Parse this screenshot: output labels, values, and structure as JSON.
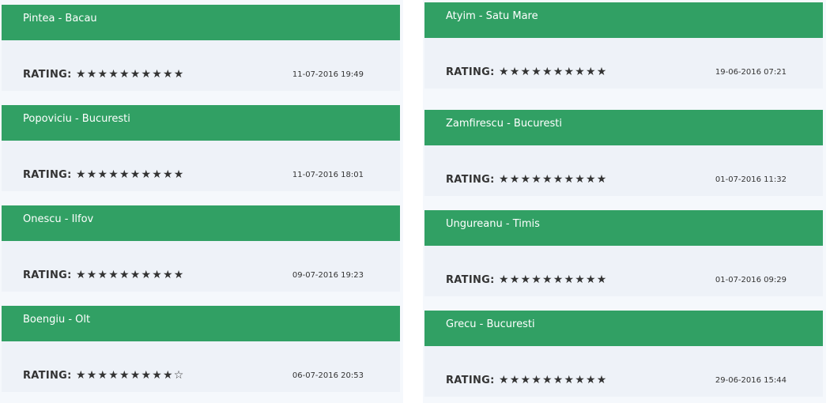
{
  "rating_label": "RATING:",
  "reviews_left": [
    {
      "name": "Pintea - Bacau",
      "stars": "★★★★★★★★★★",
      "date": "11-07-2016 19:49"
    },
    {
      "name": "Popoviciu - Bucuresti",
      "stars": "★★★★★★★★★★",
      "date": "11-07-2016 18:01"
    },
    {
      "name": "Onescu - Ilfov",
      "stars": "★★★★★★★★★★",
      "date": "09-07-2016 19:23"
    },
    {
      "name": "Boengiu - Olt",
      "stars": "★★★★★★★★★☆",
      "date": "06-07-2016 20:53"
    }
  ],
  "reviews_right": [
    {
      "name": "Atyim - Satu Mare",
      "stars": "★★★★★★★★★★",
      "date": "19-06-2016 07:21"
    },
    {
      "name": "Zamfirescu - Bucuresti",
      "stars": "★★★★★★★★★★",
      "date": "01-07-2016 11:32"
    },
    {
      "name": "Ungureanu - Timis",
      "stars": "★★★★★★★★★★",
      "date": "01-07-2016 09:29"
    },
    {
      "name": "Grecu - Bucuresti",
      "stars": "★★★★★★★★★★",
      "date": "29-06-2016 15:44"
    }
  ],
  "colors": {
    "header_green": "#31a064",
    "body_bg": "#eef2f8"
  }
}
